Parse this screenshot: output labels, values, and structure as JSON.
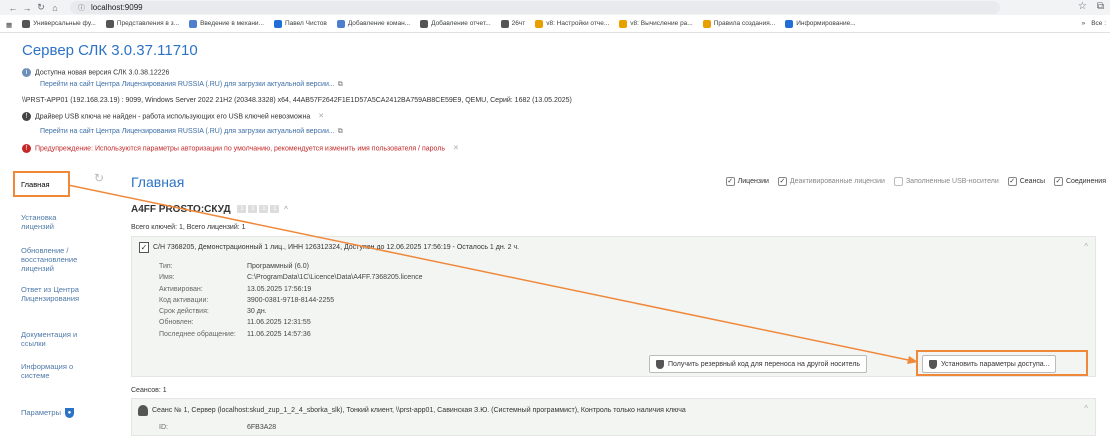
{
  "browser": {
    "url": "localhost:9099",
    "bookmarks": [
      {
        "label": "Универсальные фу...",
        "color": "#555"
      },
      {
        "label": "Представления в з...",
        "color": "#555"
      },
      {
        "label": "Введение в механи...",
        "color": "#4f7dcf"
      },
      {
        "label": "Павел Чистов",
        "color": "#1f6fd6"
      },
      {
        "label": "Добавление коман...",
        "color": "#4f7dcf"
      },
      {
        "label": "Добавление отчет...",
        "color": "#555"
      },
      {
        "label": "26чт",
        "color": "#555"
      },
      {
        "label": "v8: Настройки отче...",
        "color": "#e8a000"
      },
      {
        "label": "v8: Вычисление ра...",
        "color": "#e8a000"
      },
      {
        "label": "Правила создания...",
        "color": "#e8a000"
      },
      {
        "label": "Информирование...",
        "color": "#1f6fd6"
      }
    ],
    "bookmarks_more": "»",
    "all_bookmarks": "Все :"
  },
  "header": {
    "title": "Сервер СЛК 3.0.37.11710",
    "new_version": "Доступна новая версия СЛК 3.0.38.12226",
    "new_version_link": "Перейти на сайт Центра Лицензирования RUSSIA (.RU) для загрузки актуальной версии...",
    "server_info": "\\\\PRST-APP01 (192.168.23.19) : 9099,  Windows Server 2022 21H2 (20348.3328) x64,  44AB57F2642F1E1D57A5CA2412BA759AB8CE59E9,  QEMU,  Серий: 1682 (13.05.2025)",
    "usb_driver": "Драйвер USB ключа не найден - работа использующих его USB ключей невозможна",
    "usb_link": "Перейти на сайт Центра Лицензирования RUSSIA (.RU) для загрузки актуальной версии...",
    "warning": "Предупреждение: Используются параметры авторизации по умолчанию, рекомендуется изменить имя пользователя / пароль"
  },
  "sidebar": {
    "items": [
      {
        "label": "Главная"
      },
      {
        "label": "Установка\nлицензий"
      },
      {
        "label": "Обновление /\nвосстановление\nлицензий"
      },
      {
        "label": "Ответ из Центра\nЛицензирования"
      },
      {
        "label": "Документация и\nссылки"
      },
      {
        "label": "Информация о\nсистеме"
      },
      {
        "label": "Параметры"
      }
    ]
  },
  "main": {
    "title": "Главная",
    "filters": [
      {
        "label": "Лицензии",
        "checked": true
      },
      {
        "label": "Деактивированные лицензии",
        "checked": true
      },
      {
        "label": "Заполненные USB-носители",
        "checked": false
      },
      {
        "label": "Сеансы",
        "checked": true
      },
      {
        "label": "Соединения",
        "checked": true
      }
    ],
    "package": "A4FF PROSTO:СКУД",
    "pills": [
      "1",
      "1",
      "1",
      "1"
    ],
    "totals": "Всего ключей: 1,  Всего лицензий: 1",
    "license": {
      "header": "С/Н 7368205,  Демонстрационный 1 лиц.,  ИНН 126312324,  Доступен до 12.06.2025 17:56:19 - Осталось 1 дн. 2 ч.",
      "fields": [
        {
          "k": "Тип:",
          "v": "Программный (6.0)"
        },
        {
          "k": "Имя:",
          "v": "C:\\ProgramData\\1C\\Licence\\Data\\A4FF.7368205.licence"
        },
        {
          "k": "Активирован:",
          "v": "13.05.2025 17:56:19"
        },
        {
          "k": "Код активации:",
          "v": "3900-0381-9718-8144-2255"
        },
        {
          "k": "Срок действия:",
          "v": "30 дн."
        },
        {
          "k": "Обновлен:",
          "v": "11.06.2025 12:31:55"
        },
        {
          "k": "Последнее обращение:",
          "v": "11.06.2025 14:57:36"
        }
      ],
      "btn_reserve": "Получить резервный код для переноса на другой носитель",
      "btn_access": "Установить параметры доступа..."
    },
    "sessions_count": "Сеансов: 1",
    "session": {
      "header": "Сеанс № 1,  Сервер (localhost:skud_zup_1_2_4_sborka_slk),  Тонкий клиент,  \\\\prst-app01,  Савинская З.Ю. (Системный программист),  Контроль только наличия ключа",
      "id_label": "ID:",
      "id_value": "6FB3A28"
    }
  },
  "colors": {
    "accent": "#2c73c8",
    "highlight": "#f0883a",
    "warning": "#c62828"
  }
}
